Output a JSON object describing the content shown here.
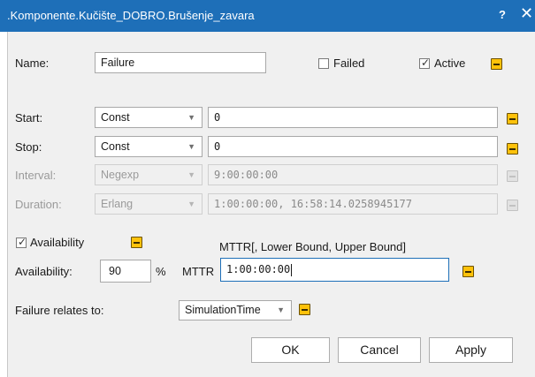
{
  "window": {
    "title": ".Komponente.Kučište_DOBRO.Brušenje_zavara",
    "help_label": "?",
    "close_label": "✕"
  },
  "name_row": {
    "label": "Name:",
    "value": "Failure",
    "failed_label": "Failed",
    "failed_checked": false,
    "active_label": "Active",
    "active_checked": true
  },
  "timing": {
    "start": {
      "label": "Start:",
      "mode": "Const",
      "value": "0",
      "enabled": true
    },
    "stop": {
      "label": "Stop:",
      "mode": "Const",
      "value": "0",
      "enabled": true
    },
    "interval": {
      "label": "Interval:",
      "mode": "Negexp",
      "value": "9:00:00:00",
      "enabled": false
    },
    "duration": {
      "label": "Duration:",
      "mode": "Erlang",
      "value": "1:00:00:00, 16:58:14.0258945177",
      "enabled": false
    }
  },
  "availability": {
    "checkbox_label": "Availability",
    "checked": true,
    "hint": "MTTR[, Lower Bound, Upper Bound]",
    "label": "Availability:",
    "value": "90",
    "unit": "%",
    "mttr_label": "MTTR",
    "mttr_value": "1:00:00:00"
  },
  "relates": {
    "label": "Failure relates to:",
    "value": "SimulationTime"
  },
  "buttons": {
    "ok": "OK",
    "cancel": "Cancel",
    "apply": "Apply"
  },
  "colors": {
    "titlebar": "#1e6fb8",
    "dialog_bg": "#f0f0f0",
    "edit_button": "#ffc20a"
  }
}
